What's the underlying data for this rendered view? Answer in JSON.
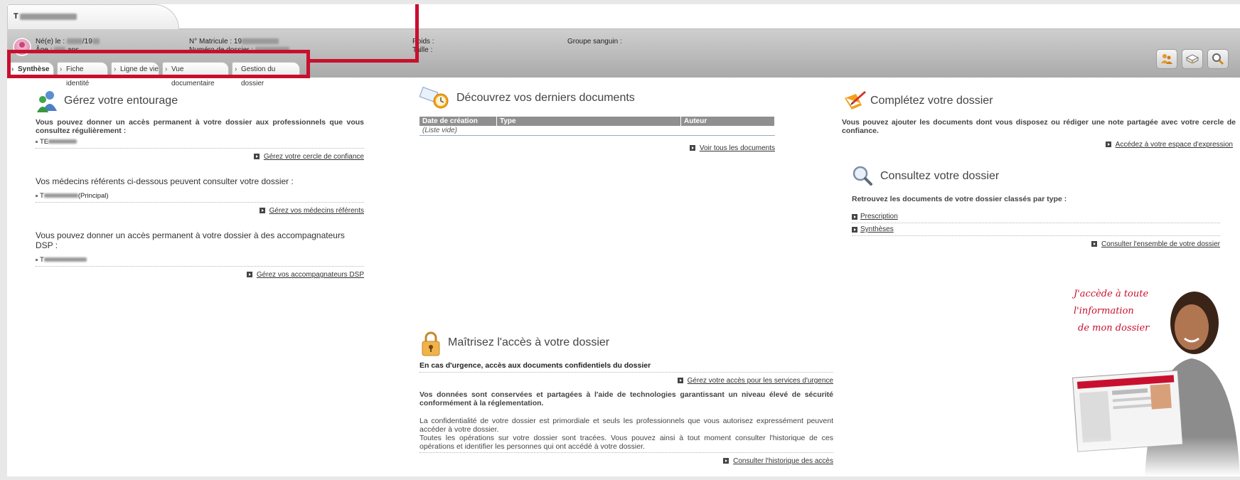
{
  "patient": {
    "name_initial": "T",
    "born_label": "Né(e) le :",
    "born_value_suffix": "/19",
    "age_label": "Âge :",
    "age_suffix": "ans",
    "matricule_label": "N° Matricule :",
    "matricule_prefix": "19",
    "dossier_label": "Numéro de dossier :",
    "poids_label": "Poids :",
    "taille_label": "Taille :",
    "groupe_label": "Groupe sanguin :"
  },
  "tabs": [
    {
      "label": "Synthèse"
    },
    {
      "label": "Fiche identité"
    },
    {
      "label": "Ligne de vie"
    },
    {
      "label": "Vue documentaire"
    },
    {
      "label": "Gestion du dossier"
    }
  ],
  "toolbar": {
    "icons": [
      "users-settings-icon",
      "book-icon",
      "search-icon"
    ]
  },
  "entourage": {
    "title": "Gérez votre entourage",
    "intro": "Vous pouvez donner un accès permanent à votre dossier aux professionnels que vous consultez régulièrement :",
    "pro_item": "TE",
    "link_cercle": "Gérez votre cercle de confiance",
    "medecins_text": "Vos médecins référents ci-dessous peuvent consulter votre dossier :",
    "medecin_item_prefix": "T",
    "medecin_item_suffix": "(Principal)",
    "link_medecins": "Gérez vos médecins référents",
    "dsp_text": "Vous pouvez donner un accès permanent à votre dossier à des accompagnateurs DSP :",
    "dsp_item": "T",
    "link_dsp": "Gérez vos accompagnateurs DSP"
  },
  "documents": {
    "title": "Découvrez vos derniers documents",
    "columns": [
      "Date de création",
      "Type",
      "Auteur"
    ],
    "empty": "(Liste vide)",
    "link_all": "Voir tous les documents"
  },
  "acces": {
    "title": "Maîtrisez l'accès à votre dossier",
    "urgence_heading": "En cas d'urgence, accès aux documents confidentiels du dossier",
    "link_urgence": "Gérez votre accès pour les services d'urgence",
    "securite_text": "Vos données sont conservées et partagées à l'aide de technologies garantissant un niveau élevé de sécurité conformément à la réglementation.",
    "confidentialite_text": "La confidentialité de votre dossier est primordiale et seuls les professionnels que vous autorisez expressément peuvent accéder à votre dossier.",
    "tracees_text": "Toutes les opérations sur votre dossier sont tracées. Vous pouvez ainsi à tout moment consulter l'historique de ces opérations et identifier les personnes qui ont accédé à votre dossier.",
    "link_historique": "Consulter l'historique des accès"
  },
  "completez": {
    "title": "Complétez votre dossier",
    "text": "Vous pouvez ajouter les documents dont vous disposez ou rédiger une note partagée avec votre cercle de confiance.",
    "link_expression": "Accédez à votre espace d'expression"
  },
  "consultez": {
    "title": "Consultez votre dossier",
    "text": "Retrouvez les documents de votre dossier classés par type :",
    "types": [
      "Prescription",
      "Synthèses"
    ],
    "link_ensemble": "Consulter l'ensemble de votre dossier"
  },
  "promo": {
    "line1": "J'accède à toute",
    "line2": "l'information",
    "line3": "de mon dossier"
  },
  "colors": {
    "highlight": "#c8102e",
    "header_gray": "#a9a9a9"
  }
}
